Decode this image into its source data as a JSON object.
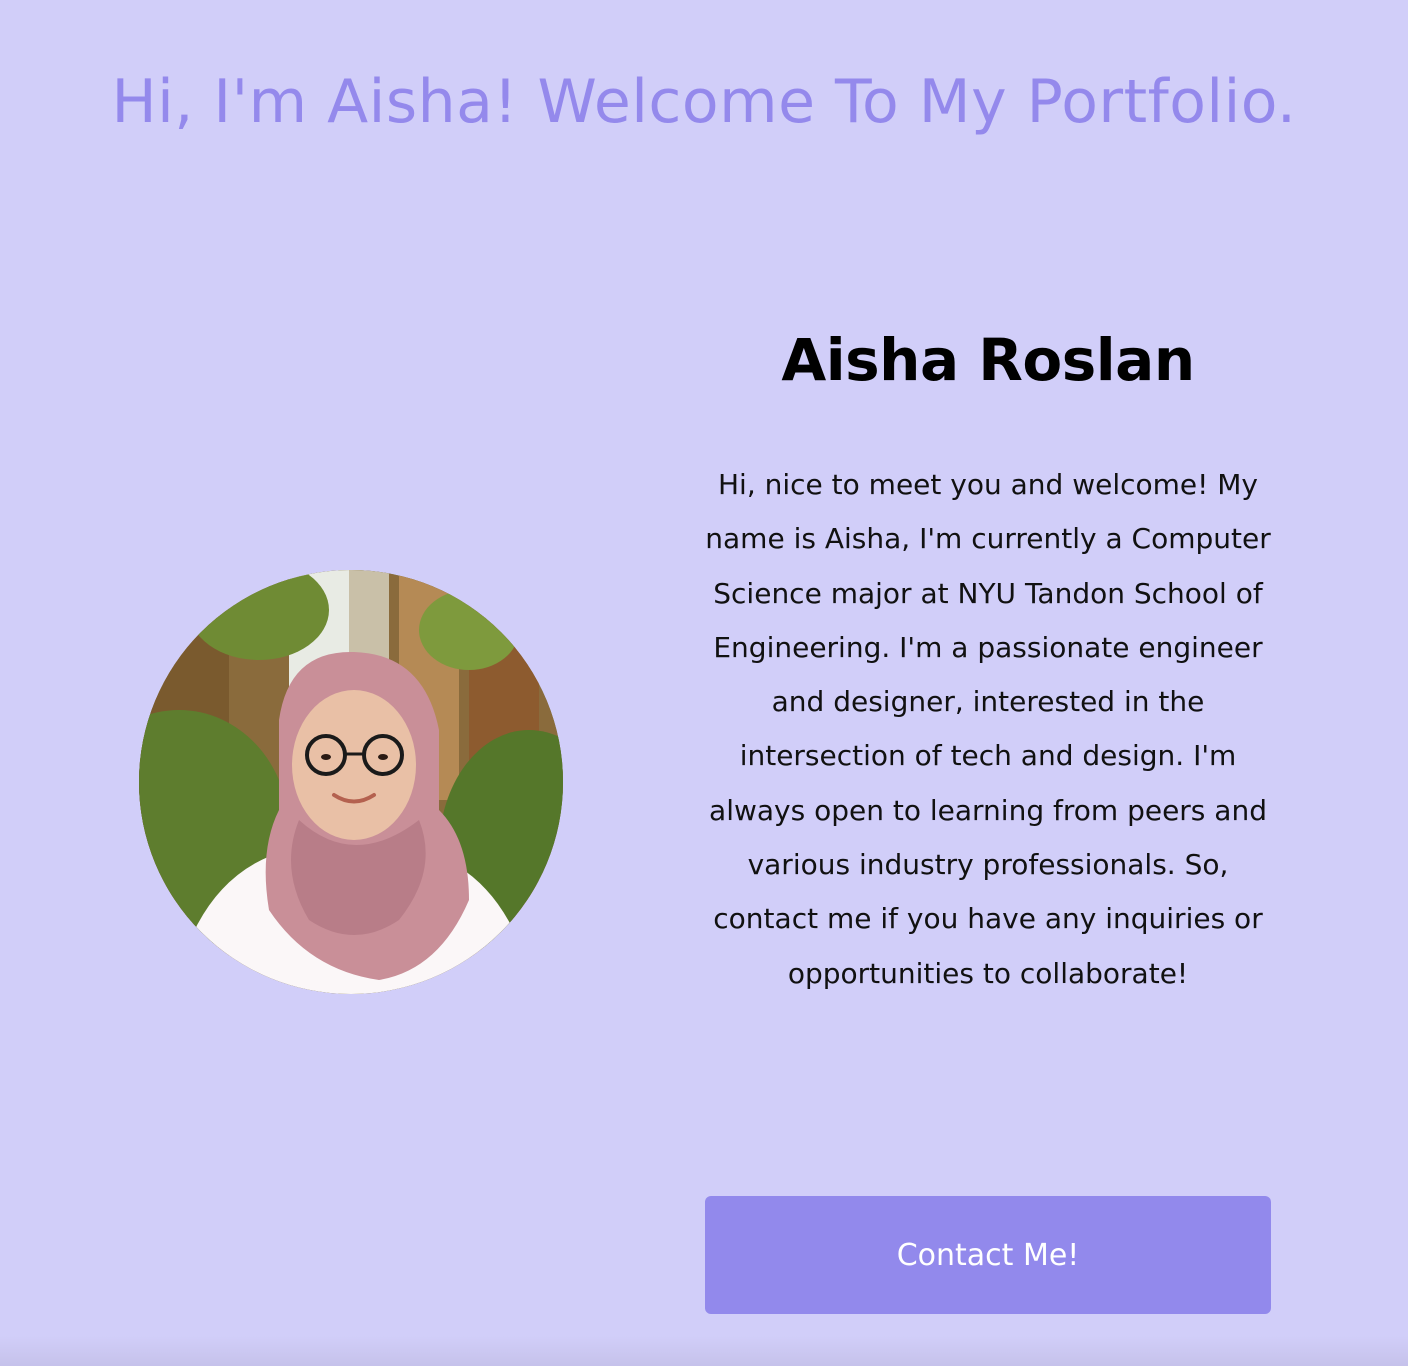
{
  "header": {
    "title": "Hi, I'm Aisha! Welcome To My Portfolio."
  },
  "profile": {
    "photo_alt": "Aisha Roslan portrait",
    "name": "Aisha Roslan",
    "bio": "Hi, nice to meet you and welcome! My name is Aisha, I'm currently a Computer Science major at NYU Tandon School of Engineering. I'm a passionate engineer and designer, interested in the intersection of tech and design. I'm always open to learning from peers and various industry professionals. So, contact me if you have any inquiries or opportunities to collaborate!",
    "contact_label": "Contact Me!"
  },
  "colors": {
    "background": "#d1cef9",
    "accent": "#9489ec",
    "button": "#9289ec",
    "button_text": "#ffffff",
    "name_text": "#000000"
  }
}
